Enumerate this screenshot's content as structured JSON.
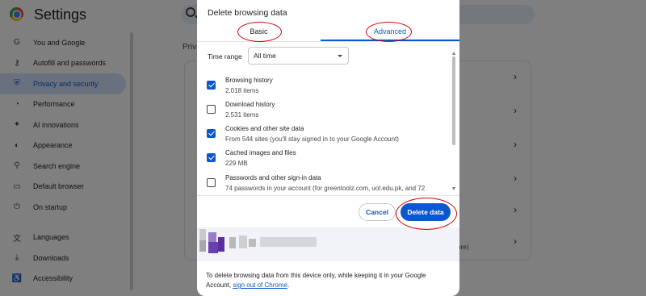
{
  "app": {
    "title": "Settings"
  },
  "sidebar": {
    "items": [
      {
        "label": "You and Google",
        "icon": "google-icon"
      },
      {
        "label": "Autofill and passwords",
        "icon": "key-icon"
      },
      {
        "label": "Privacy and security",
        "icon": "shield-icon",
        "active": true
      },
      {
        "label": "Performance",
        "icon": "speedometer-icon"
      },
      {
        "label": "AI innovations",
        "icon": "sparkle-icon"
      },
      {
        "label": "Appearance",
        "icon": "palette-icon"
      },
      {
        "label": "Search engine",
        "icon": "search-icon"
      },
      {
        "label": "Default browser",
        "icon": "browser-icon"
      },
      {
        "label": "On startup",
        "icon": "power-icon"
      },
      {
        "label": "Languages",
        "icon": "translate-icon"
      },
      {
        "label": "Downloads",
        "icon": "download-icon"
      },
      {
        "label": "Accessibility",
        "icon": "accessibility-icon"
      }
    ]
  },
  "main": {
    "section_label": "Priva",
    "card_partial_text": "ore)"
  },
  "dialog": {
    "title": "Delete browsing data",
    "tabs": {
      "basic": "Basic",
      "advanced": "Advanced",
      "selected": "advanced"
    },
    "time_range": {
      "label": "Time range",
      "value": "All time"
    },
    "options": [
      {
        "title": "Browsing history",
        "desc": "2,018 items",
        "checked": true
      },
      {
        "title": "Download history",
        "desc": "2,531 items",
        "checked": false
      },
      {
        "title": "Cookies and other site data",
        "desc": "From 544 sites (you'll stay signed in to your Google Account)",
        "checked": true
      },
      {
        "title": "Cached images and files",
        "desc": "229 MB",
        "checked": true
      },
      {
        "title": "Passwords and other sign-in data",
        "desc": "74 passwords in your account (for greentoolz.com, uol.edu.pk, and 72",
        "checked": false
      }
    ],
    "buttons": {
      "cancel": "Cancel",
      "delete": "Delete data"
    },
    "footer": {
      "text": "To delete browsing data from this device only, while keeping it in your Google Account, ",
      "link": "sign out of Chrome",
      "tail": "."
    }
  },
  "colors": {
    "accent": "#0b57d0",
    "annotation": "#d50000",
    "overlay": "rgba(0,0,0,0.5)"
  }
}
